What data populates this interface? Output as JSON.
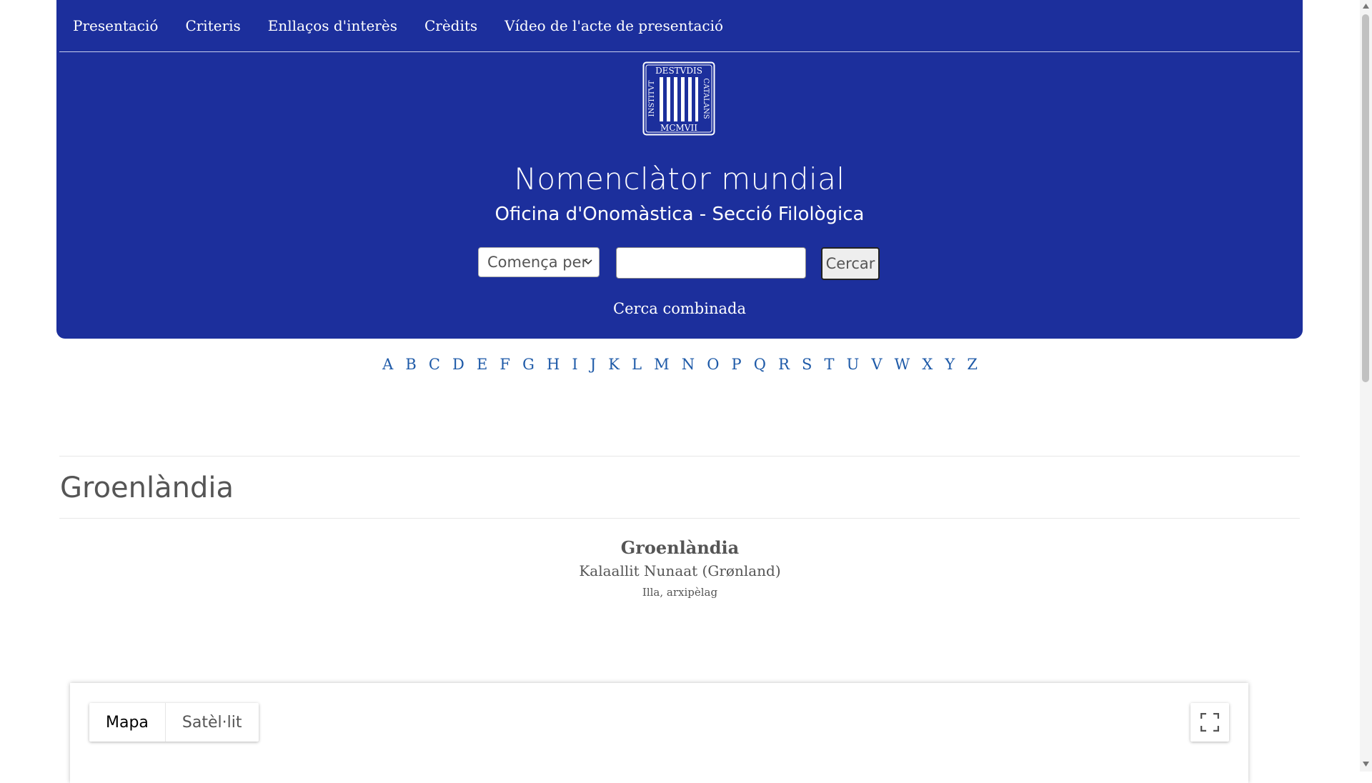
{
  "nav": {
    "items": [
      "Presentació",
      "Criteris",
      "Enllaços d'interès",
      "Crèdits",
      "Vídeo de l'acte de presentació"
    ]
  },
  "logo": {
    "top_text": "DESTVDIS",
    "left_text": "INSTITVT",
    "right_text": "CATALANS",
    "bottom_text": "MCMVII",
    "icon": "iec-seal-icon"
  },
  "header": {
    "title": "Nomenclàtor mundial",
    "subtitle": "Oficina d'Onomàstica - Secció Filològica"
  },
  "search": {
    "mode_selected": "Comença per",
    "input_value": "",
    "button_label": "Cercar",
    "combined_link": "Cerca combinada"
  },
  "alphabet": [
    "A",
    "B",
    "C",
    "D",
    "E",
    "F",
    "G",
    "H",
    "I",
    "J",
    "K",
    "L",
    "M",
    "N",
    "O",
    "P",
    "Q",
    "R",
    "S",
    "T",
    "U",
    "V",
    "W",
    "X",
    "Y",
    "Z"
  ],
  "page": {
    "title": "Groenlàndia"
  },
  "entry": {
    "name": "Groenlàndia",
    "native_name": "Kalaallit Nunaat (Grønland)",
    "type": "Illa, arxipèlag"
  },
  "map": {
    "types": [
      "Mapa",
      "Satèl·lit"
    ],
    "active_type": "Mapa",
    "fullscreen_icon": "fullscreen-icon"
  },
  "colors": {
    "header_bg": "#1c2f9c",
    "link_blue": "#1e5aa8"
  }
}
